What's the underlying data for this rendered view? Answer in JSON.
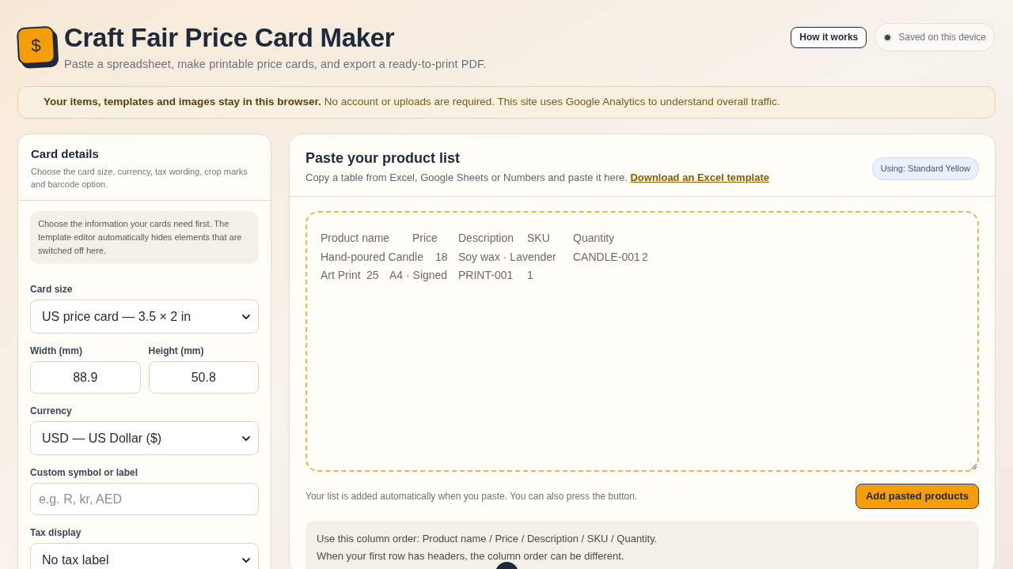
{
  "header": {
    "logo": {
      "glyph": "$"
    },
    "title": "Craft Fair Price Card Maker",
    "subtitle": "Paste a spreadsheet, make printable price cards, and export a ready-to-print PDF.",
    "help_button": {
      "label": "How it works"
    },
    "status": {
      "label": "Saved on this device"
    }
  },
  "notice": {
    "text": "**Your items, templates and images stay in this browser.** No account or uploads are required. This site uses Google Analytics to understand overall traffic."
  },
  "card_details": {
    "title": "Card details",
    "description": "Choose the card size, currency, tax wording, crop marks and barcode option.",
    "note": "Choose the information your cards need first. The template editor automatically hides elements that are switched off here.",
    "fields": [
      {
        "kind": "select",
        "label": "Card size",
        "value": "US price card — 3.5 × 2 in"
      },
      {
        "kind": "number",
        "label": "Width (mm)",
        "value": "88.9"
      },
      {
        "kind": "number",
        "label": "Height (mm)",
        "value": "50.8"
      },
      {
        "kind": "select",
        "label": "Currency",
        "value": "USD — US Dollar ($)"
      },
      {
        "kind": "text",
        "label": "Custom symbol or label",
        "placeholder": "e.g. R, kr, AED"
      },
      {
        "kind": "select",
        "label": "Tax display",
        "value": "No tax label"
      }
    ]
  },
  "paste_panel": {
    "title": "Paste your product list",
    "description": "Copy a table from Excel, Google Sheets or Numbers and paste it here.",
    "link": "Download an Excel template",
    "badge": "Using: Standard Yellow",
    "textarea": {
      "lines": [
        "Product name\tPrice\tDescription\tSKU\tQuantity",
        "Hand-poured Candle\t18\tSoy wax · Lavender\tCANDLE-001\t2",
        "Art Print\t25\tA4 · Signed\tPRINT-001\t1"
      ]
    },
    "hint": "Your list is added automatically when you paste. You can also press the button.",
    "button": {
      "label": "Add pasted products"
    },
    "info": {
      "lines": [
        "Use this column order: Product name / Price / Description / SKU / Quantity.",
        "When your first row has headers, the column order can be different."
      ]
    }
  }
}
